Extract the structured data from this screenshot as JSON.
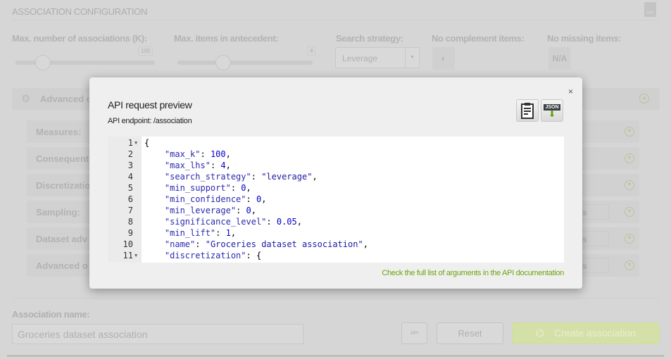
{
  "background": {
    "title": "ASSOCIATION CONFIGURATION",
    "pdf_icon": "pdf-file-icon",
    "fields": {
      "max_k": {
        "label": "Max. number of associations (K):",
        "value": "100"
      },
      "max_lhs": {
        "label": "Max. items in antecedent:",
        "value": "4"
      },
      "search_strategy": {
        "label": "Search strategy:",
        "value": "Leverage"
      },
      "no_complement": {
        "label": "No complement items:"
      },
      "no_missing": {
        "label": "No missing items:",
        "value": "N/A"
      }
    },
    "advanced_header": "Advanced c",
    "rows": [
      "Measures:",
      "Consequent",
      "Discretizatio",
      "Sampling:",
      "Dataset adv",
      "Advanced o"
    ],
    "row_box_text": "s",
    "name_label": "Association name:",
    "name_value": "Groceries dataset association",
    "api_button": "API",
    "reset_button": "Reset",
    "create_button": "Create association"
  },
  "modal": {
    "title": "API request preview",
    "endpoint": "API endpoint: /association",
    "close": "×",
    "json_icon_label": "JSON",
    "doc_link": "Check the full list of arguments in the API documentation",
    "code_lines": [
      {
        "n": "1",
        "fold": true,
        "parts": [
          [
            "p",
            "{"
          ]
        ]
      },
      {
        "n": "2",
        "parts": [
          [
            "p",
            "    "
          ],
          [
            "k",
            "\"max_k\""
          ],
          [
            "p",
            ": "
          ],
          [
            "n",
            "100"
          ],
          [
            "p",
            ","
          ]
        ]
      },
      {
        "n": "3",
        "parts": [
          [
            "p",
            "    "
          ],
          [
            "k",
            "\"max_lhs\""
          ],
          [
            "p",
            ": "
          ],
          [
            "n",
            "4"
          ],
          [
            "p",
            ","
          ]
        ]
      },
      {
        "n": "4",
        "parts": [
          [
            "p",
            "    "
          ],
          [
            "k",
            "\"search_strategy\""
          ],
          [
            "p",
            ": "
          ],
          [
            "s",
            "\"leverage\""
          ],
          [
            "p",
            ","
          ]
        ]
      },
      {
        "n": "5",
        "parts": [
          [
            "p",
            "    "
          ],
          [
            "k",
            "\"min_support\""
          ],
          [
            "p",
            ": "
          ],
          [
            "n",
            "0"
          ],
          [
            "p",
            ","
          ]
        ]
      },
      {
        "n": "6",
        "parts": [
          [
            "p",
            "    "
          ],
          [
            "k",
            "\"min_confidence\""
          ],
          [
            "p",
            ": "
          ],
          [
            "n",
            "0"
          ],
          [
            "p",
            ","
          ]
        ]
      },
      {
        "n": "7",
        "parts": [
          [
            "p",
            "    "
          ],
          [
            "k",
            "\"min_leverage\""
          ],
          [
            "p",
            ": "
          ],
          [
            "n",
            "0"
          ],
          [
            "p",
            ","
          ]
        ]
      },
      {
        "n": "8",
        "parts": [
          [
            "p",
            "    "
          ],
          [
            "k",
            "\"significance_level\""
          ],
          [
            "p",
            ": "
          ],
          [
            "n",
            "0.05"
          ],
          [
            "p",
            ","
          ]
        ]
      },
      {
        "n": "9",
        "parts": [
          [
            "p",
            "    "
          ],
          [
            "k",
            "\"min_lift\""
          ],
          [
            "p",
            ": "
          ],
          [
            "n",
            "1"
          ],
          [
            "p",
            ","
          ]
        ]
      },
      {
        "n": "10",
        "parts": [
          [
            "p",
            "    "
          ],
          [
            "k",
            "\"name\""
          ],
          [
            "p",
            ": "
          ],
          [
            "s",
            "\"Groceries dataset association\""
          ],
          [
            "p",
            ","
          ]
        ]
      },
      {
        "n": "11",
        "fold": true,
        "parts": [
          [
            "p",
            "    "
          ],
          [
            "k",
            "\"discretization\""
          ],
          [
            "p",
            ": {"
          ]
        ]
      }
    ]
  },
  "colors": {
    "link": "#6aa50a",
    "create_button": "#d3e0a8"
  }
}
